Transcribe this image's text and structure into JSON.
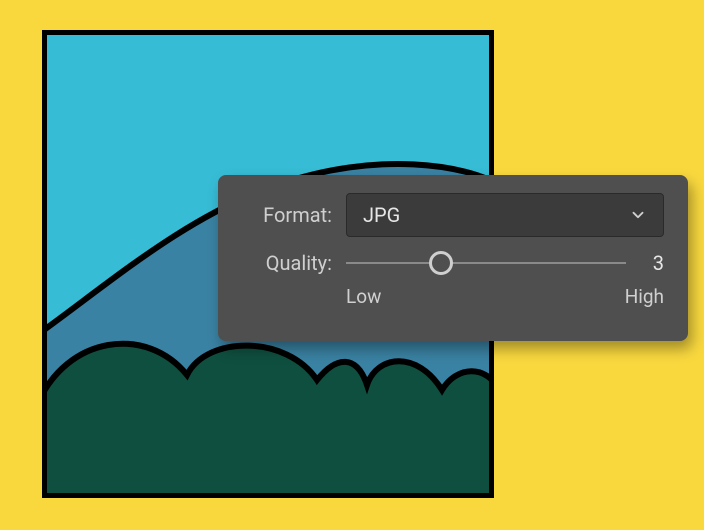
{
  "panel": {
    "format_label": "Format:",
    "format_value": "JPG",
    "quality_label": "Quality:",
    "quality_value": 3,
    "quality_low_label": "Low",
    "quality_high_label": "High",
    "quality_thumb_left_pct": 34
  }
}
